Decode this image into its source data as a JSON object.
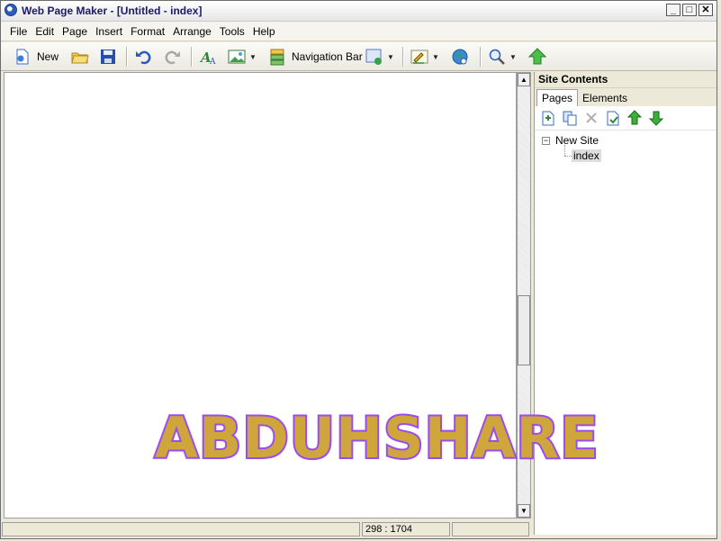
{
  "window": {
    "title": "Web Page Maker - [Untitled - index]"
  },
  "window_buttons": [
    "_",
    "□",
    "✕"
  ],
  "menu": [
    "File",
    "Edit",
    "Page",
    "Insert",
    "Format",
    "Arrange",
    "Tools",
    "Help"
  ],
  "toolbar": {
    "new_label": "New",
    "navbar_label": "Navigation Bar"
  },
  "panel": {
    "title": "Site Contents",
    "tabs": [
      "Pages",
      "Elements"
    ],
    "tree_root": "New Site",
    "tree_child": "index"
  },
  "status": {
    "coords": "298 : 1704"
  },
  "watermark": "ABDUHSHARE",
  "colors": {
    "watermark_fill": "#cfa63b",
    "watermark_stroke": "#9b4bf0"
  }
}
